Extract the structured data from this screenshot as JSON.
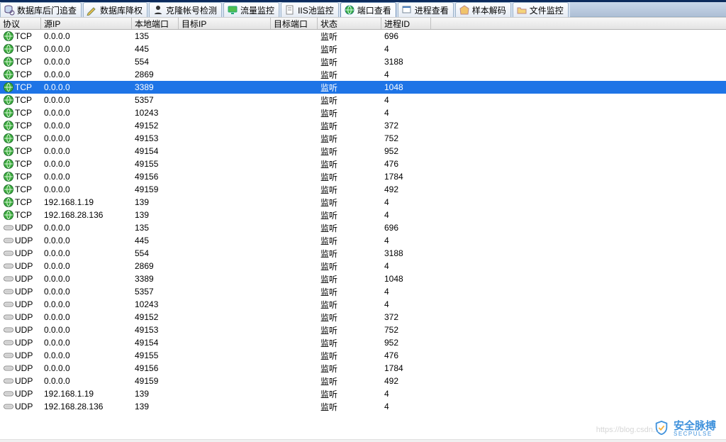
{
  "tabs": [
    {
      "id": "db-backdoor",
      "label": "数据库后门追查",
      "icon": "db-search"
    },
    {
      "id": "db-privdrop",
      "label": "数据库降权",
      "icon": "pencil"
    },
    {
      "id": "clone-account",
      "label": "克隆帐号检测",
      "icon": "user"
    },
    {
      "id": "traffic",
      "label": "流量监控",
      "icon": "monitor-green"
    },
    {
      "id": "iis-pool",
      "label": "IIS池监控",
      "icon": "page"
    },
    {
      "id": "port-view",
      "label": "端口查看",
      "icon": "globe",
      "active": true
    },
    {
      "id": "process-view",
      "label": "进程查看",
      "icon": "windows"
    },
    {
      "id": "sample-decode",
      "label": "样本解码",
      "icon": "tag"
    },
    {
      "id": "file-monitor",
      "label": "文件监控",
      "icon": "folder"
    }
  ],
  "columns": {
    "proto": "协议",
    "src": "源IP",
    "lport": "本地端口",
    "dst": "目标IP",
    "dport": "目标端口",
    "state": "状态",
    "pid": "进程ID"
  },
  "rows": [
    {
      "proto": "TCP",
      "src": "0.0.0.0",
      "lport": "135",
      "dst": "",
      "dport": "",
      "state": "监听",
      "pid": "696",
      "sel": false
    },
    {
      "proto": "TCP",
      "src": "0.0.0.0",
      "lport": "445",
      "dst": "",
      "dport": "",
      "state": "监听",
      "pid": "4",
      "sel": false
    },
    {
      "proto": "TCP",
      "src": "0.0.0.0",
      "lport": "554",
      "dst": "",
      "dport": "",
      "state": "监听",
      "pid": "3188",
      "sel": false
    },
    {
      "proto": "TCP",
      "src": "0.0.0.0",
      "lport": "2869",
      "dst": "",
      "dport": "",
      "state": "监听",
      "pid": "4",
      "sel": false
    },
    {
      "proto": "TCP",
      "src": "0.0.0.0",
      "lport": "3389",
      "dst": "",
      "dport": "",
      "state": "监听",
      "pid": "1048",
      "sel": true
    },
    {
      "proto": "TCP",
      "src": "0.0.0.0",
      "lport": "5357",
      "dst": "",
      "dport": "",
      "state": "监听",
      "pid": "4",
      "sel": false
    },
    {
      "proto": "TCP",
      "src": "0.0.0.0",
      "lport": "10243",
      "dst": "",
      "dport": "",
      "state": "监听",
      "pid": "4",
      "sel": false
    },
    {
      "proto": "TCP",
      "src": "0.0.0.0",
      "lport": "49152",
      "dst": "",
      "dport": "",
      "state": "监听",
      "pid": "372",
      "sel": false
    },
    {
      "proto": "TCP",
      "src": "0.0.0.0",
      "lport": "49153",
      "dst": "",
      "dport": "",
      "state": "监听",
      "pid": "752",
      "sel": false
    },
    {
      "proto": "TCP",
      "src": "0.0.0.0",
      "lport": "49154",
      "dst": "",
      "dport": "",
      "state": "监听",
      "pid": "952",
      "sel": false
    },
    {
      "proto": "TCP",
      "src": "0.0.0.0",
      "lport": "49155",
      "dst": "",
      "dport": "",
      "state": "监听",
      "pid": "476",
      "sel": false
    },
    {
      "proto": "TCP",
      "src": "0.0.0.0",
      "lport": "49156",
      "dst": "",
      "dport": "",
      "state": "监听",
      "pid": "1784",
      "sel": false
    },
    {
      "proto": "TCP",
      "src": "0.0.0.0",
      "lport": "49159",
      "dst": "",
      "dport": "",
      "state": "监听",
      "pid": "492",
      "sel": false
    },
    {
      "proto": "TCP",
      "src": "192.168.1.19",
      "lport": "139",
      "dst": "",
      "dport": "",
      "state": "监听",
      "pid": "4",
      "sel": false
    },
    {
      "proto": "TCP",
      "src": "192.168.28.136",
      "lport": "139",
      "dst": "",
      "dport": "",
      "state": "监听",
      "pid": "4",
      "sel": false
    },
    {
      "proto": "UDP",
      "src": "0.0.0.0",
      "lport": "135",
      "dst": "",
      "dport": "",
      "state": "监听",
      "pid": "696",
      "sel": false
    },
    {
      "proto": "UDP",
      "src": "0.0.0.0",
      "lport": "445",
      "dst": "",
      "dport": "",
      "state": "监听",
      "pid": "4",
      "sel": false
    },
    {
      "proto": "UDP",
      "src": "0.0.0.0",
      "lport": "554",
      "dst": "",
      "dport": "",
      "state": "监听",
      "pid": "3188",
      "sel": false
    },
    {
      "proto": "UDP",
      "src": "0.0.0.0",
      "lport": "2869",
      "dst": "",
      "dport": "",
      "state": "监听",
      "pid": "4",
      "sel": false
    },
    {
      "proto": "UDP",
      "src": "0.0.0.0",
      "lport": "3389",
      "dst": "",
      "dport": "",
      "state": "监听",
      "pid": "1048",
      "sel": false
    },
    {
      "proto": "UDP",
      "src": "0.0.0.0",
      "lport": "5357",
      "dst": "",
      "dport": "",
      "state": "监听",
      "pid": "4",
      "sel": false
    },
    {
      "proto": "UDP",
      "src": "0.0.0.0",
      "lport": "10243",
      "dst": "",
      "dport": "",
      "state": "监听",
      "pid": "4",
      "sel": false
    },
    {
      "proto": "UDP",
      "src": "0.0.0.0",
      "lport": "49152",
      "dst": "",
      "dport": "",
      "state": "监听",
      "pid": "372",
      "sel": false
    },
    {
      "proto": "UDP",
      "src": "0.0.0.0",
      "lport": "49153",
      "dst": "",
      "dport": "",
      "state": "监听",
      "pid": "752",
      "sel": false
    },
    {
      "proto": "UDP",
      "src": "0.0.0.0",
      "lport": "49154",
      "dst": "",
      "dport": "",
      "state": "监听",
      "pid": "952",
      "sel": false
    },
    {
      "proto": "UDP",
      "src": "0.0.0.0",
      "lport": "49155",
      "dst": "",
      "dport": "",
      "state": "监听",
      "pid": "476",
      "sel": false
    },
    {
      "proto": "UDP",
      "src": "0.0.0.0",
      "lport": "49156",
      "dst": "",
      "dport": "",
      "state": "监听",
      "pid": "1784",
      "sel": false
    },
    {
      "proto": "UDP",
      "src": "0.0.0.0",
      "lport": "49159",
      "dst": "",
      "dport": "",
      "state": "监听",
      "pid": "492",
      "sel": false
    },
    {
      "proto": "UDP",
      "src": "192.168.1.19",
      "lport": "139",
      "dst": "",
      "dport": "",
      "state": "监听",
      "pid": "4",
      "sel": false
    },
    {
      "proto": "UDP",
      "src": "192.168.28.136",
      "lport": "139",
      "dst": "",
      "dport": "",
      "state": "监听",
      "pid": "4",
      "sel": false
    }
  ],
  "watermark": {
    "brand_cn": "安全脉搏",
    "brand_en": "SECPULSE",
    "blog": "https://blog.csdn..."
  }
}
